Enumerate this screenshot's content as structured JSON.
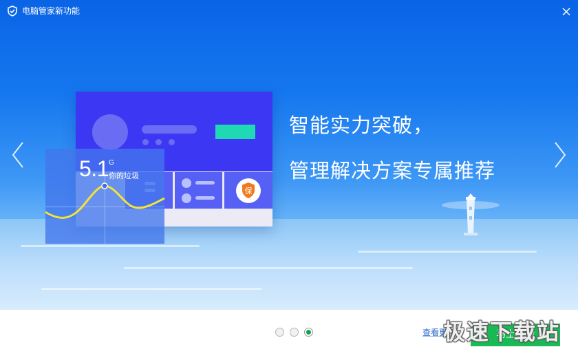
{
  "window": {
    "title": "电脑管家新功能"
  },
  "icons": {
    "app_logo": "shield-logo-icon",
    "close": "close-icon",
    "prev": "chevron-left-icon",
    "next": "chevron-right-icon",
    "badge": "shield-badge-icon"
  },
  "illustration": {
    "trash_size": "5.1",
    "trash_unit": "G",
    "trash_label": "你的垃圾",
    "badge_glyph": "保"
  },
  "headline": {
    "line1": "智能实力突破，",
    "line2": "管理解决方案专属推荐"
  },
  "pager": {
    "pages": 3,
    "current_index": 2
  },
  "footer": {
    "more_link": "查看更多",
    "primary_button": "马上体验",
    "watermark": "极速下载站"
  },
  "colors": {
    "banner_blue": "#0a64e6",
    "card_purple": "#3b37f3",
    "accent_teal": "#20d8b3",
    "wave_yellow": "#f3e338",
    "button_green": "#19b955",
    "active_dot_green": "#14a34a",
    "link_blue": "#2a68c9"
  }
}
